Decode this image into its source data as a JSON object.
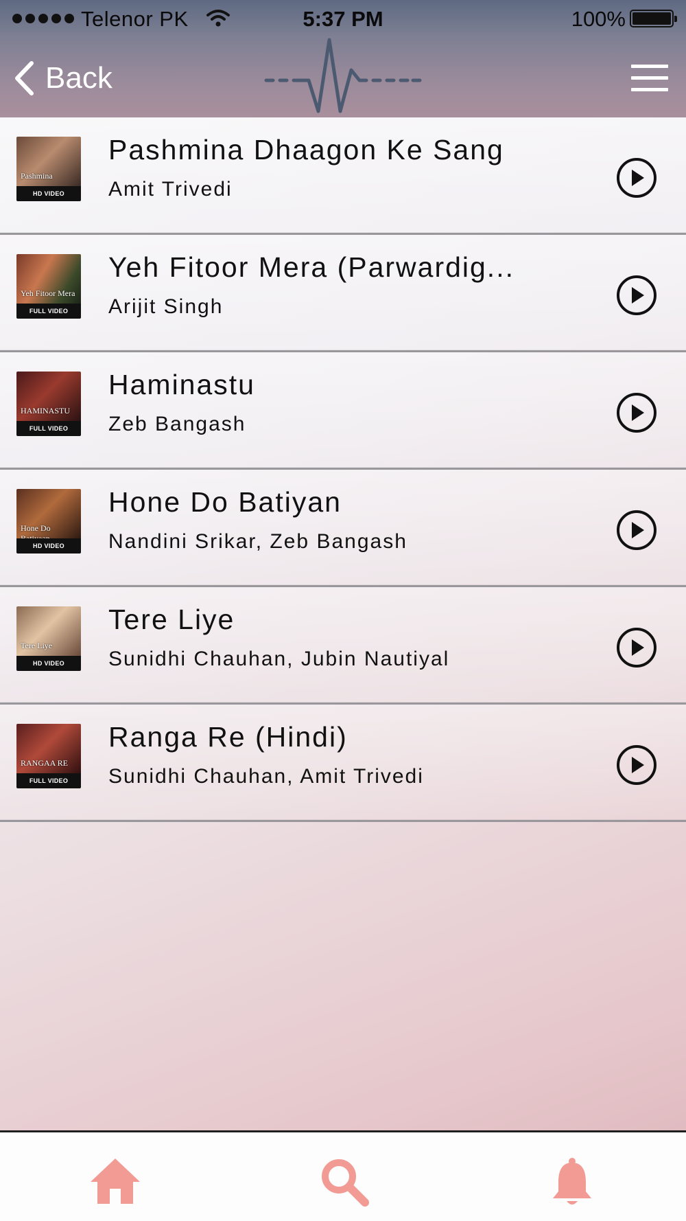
{
  "status_bar": {
    "carrier": "Telenor PK",
    "time": "5:37 PM",
    "battery": "100%"
  },
  "nav": {
    "back_label": "Back",
    "logo_icon": "heartbeat-pulse-icon",
    "menu_icon": "hamburger-menu-icon"
  },
  "songs": [
    {
      "title": "Pashmina Dhaagon Ke Sang",
      "artist": "Amit Trivedi",
      "thumb_caption": "HD VIDEO",
      "thumb_text": "Pashmina"
    },
    {
      "title": "Yeh Fitoor Mera (Parwardig...",
      "artist": "Arijit Singh",
      "thumb_caption": "FULL VIDEO",
      "thumb_text": "Yeh Fitoor Mera"
    },
    {
      "title": "Haminastu",
      "artist": "Zeb Bangash",
      "thumb_caption": "FULL VIDEO",
      "thumb_text": "HAMINASTU"
    },
    {
      "title": "Hone Do Batiyan",
      "artist": "Nandini Srikar, Zeb Bangash",
      "thumb_caption": "HD VIDEO",
      "thumb_text": "Hone Do Batiyaan"
    },
    {
      "title": "Tere Liye",
      "artist": "Sunidhi Chauhan, Jubin Nautiyal",
      "thumb_caption": "HD VIDEO",
      "thumb_text": "Tere Liye"
    },
    {
      "title": "Ranga Re (Hindi)",
      "artist": "Sunidhi Chauhan, Amit Trivedi",
      "thumb_caption": "FULL VIDEO",
      "thumb_text": "RANGAA RE"
    }
  ],
  "tabbar": {
    "tabs": [
      "home-icon",
      "search-icon",
      "bell-icon"
    ],
    "accent": "#f29a94"
  }
}
